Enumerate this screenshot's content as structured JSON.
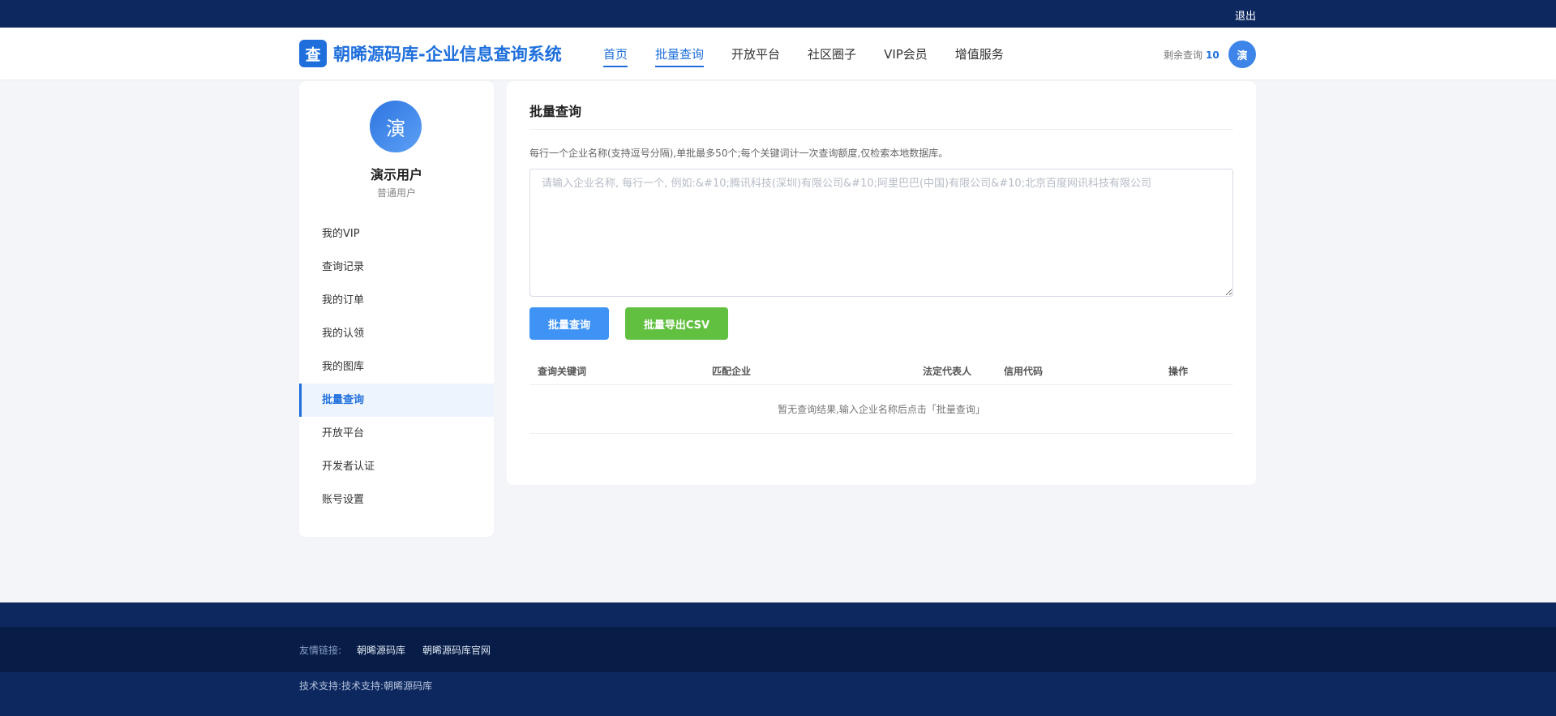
{
  "topbar": {
    "logout_label": "退出"
  },
  "header": {
    "brand_icon": "查",
    "brand_name": "朝晞源码库-企业信息查询系统",
    "nav": [
      {
        "label": "首页",
        "active": true
      },
      {
        "label": "批量查询",
        "active": true
      },
      {
        "label": "开放平台",
        "active": false
      },
      {
        "label": "社区圈子",
        "active": false
      },
      {
        "label": "VIP会员",
        "active": false
      },
      {
        "label": "增值服务",
        "active": false
      }
    ],
    "quota_label": "剩余查询",
    "quota_value": "10",
    "avatar_text": "演"
  },
  "sidebar": {
    "avatar_text": "演",
    "user_name": "演示用户",
    "user_role": "普通用户",
    "menu": [
      {
        "label": "我的VIP",
        "active": false
      },
      {
        "label": "查询记录",
        "active": false
      },
      {
        "label": "我的订单",
        "active": false
      },
      {
        "label": "我的认领",
        "active": false
      },
      {
        "label": "我的图库",
        "active": false
      },
      {
        "label": "批量查询",
        "active": true
      },
      {
        "label": "开放平台",
        "active": false
      },
      {
        "label": "开发者认证",
        "active": false
      },
      {
        "label": "账号设置",
        "active": false
      }
    ]
  },
  "main": {
    "title": "批量查询",
    "hint": "每行一个企业名称(支持逗号分隔),单批最多50个;每个关键词计一次查询额度,仅检索本地数据库。",
    "input_value": "",
    "input_placeholder": "请输入企业名称, 每行一个, 例如:&#10;腾讯科技(深圳)有限公司&#10;阿里巴巴(中国)有限公司&#10;北京百度网讯科技有限公司",
    "query_button": "批量查询",
    "export_button": "批量导出CSV",
    "table": {
      "columns": [
        "查询关键词",
        "匹配企业",
        "法定代表人",
        "信用代码",
        "操作"
      ],
      "empty_text": "暂无查询结果,输入企业名称后点击「批量查询」"
    }
  },
  "footer": {
    "friend_label": "友情链接:",
    "links": [
      "朝晞源码库",
      "朝晞源码库官网"
    ],
    "copyright": "技术支持:技术支持:朝晞源码库"
  },
  "colors": {
    "primary": "#1e6fdc",
    "navy": "#0d285f",
    "navy_dark": "#071d47",
    "export_green": "#61c040",
    "query_blue": "#3f93f5"
  },
  "icons": {
    "brand": "search-icon"
  }
}
